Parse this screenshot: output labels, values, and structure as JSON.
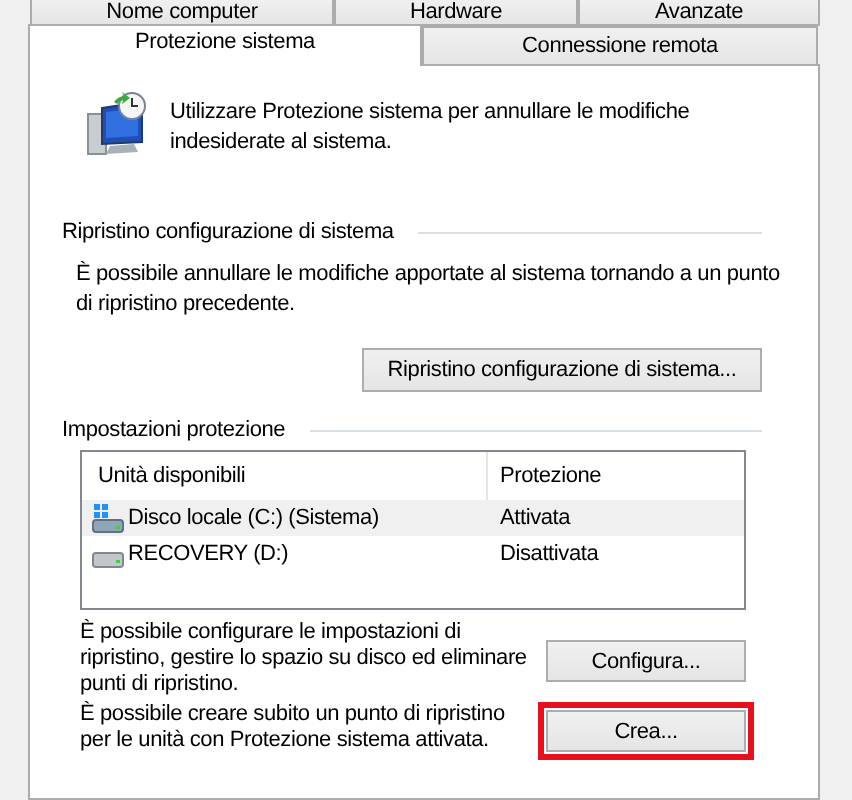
{
  "tabs_back": [
    {
      "label": "Nome computer",
      "selected": false
    },
    {
      "label": "Hardware",
      "selected": false
    },
    {
      "label": "Avanzate",
      "selected": false
    }
  ],
  "tabs_front": [
    {
      "label": "Protezione sistema",
      "selected": true
    },
    {
      "label": "Connessione remota",
      "selected": false
    }
  ],
  "intro": "Utilizzare Protezione sistema per annullare le modifiche indesiderate al sistema.",
  "restore": {
    "heading": "Ripristino configurazione di sistema",
    "text": "È possibile annullare le modifiche apportate al sistema tornando a un punto di ripristino precedente.",
    "button": {
      "label": "Ripristino configurazione di sistema...",
      "highlighted": false
    }
  },
  "protection": {
    "heading": "Impostazioni protezione",
    "columns": [
      "Unità disponibili",
      "Protezione"
    ],
    "rows": [
      {
        "kind": "system",
        "drive": "Disco locale (C:) (Sistema)",
        "status": "Attivata",
        "selected": true
      },
      {
        "kind": "plain",
        "drive": "RECOVERY (D:)",
        "status": "Disattivata",
        "selected": false
      }
    ],
    "actions": [
      {
        "text": "È possibile configurare le impostazioni di ripristino, gestire lo spazio su disco ed eliminare punti di ripristino.",
        "button": {
          "label": "Configura...",
          "highlighted": false
        }
      },
      {
        "text": "È possibile creare subito un punto di ripristino per le unità con Protezione sistema attivata.",
        "button": {
          "label": "Crea...",
          "highlighted": true
        }
      }
    ]
  }
}
